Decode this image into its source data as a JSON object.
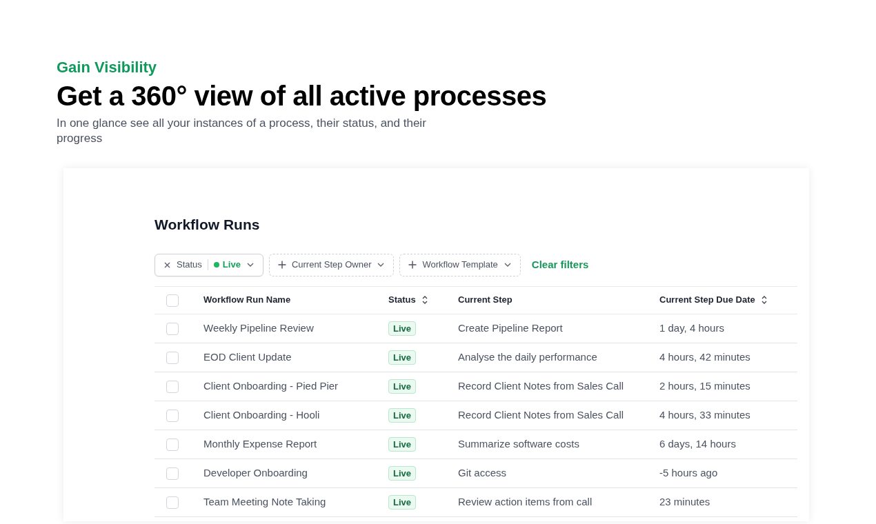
{
  "hero": {
    "eyebrow": "Gain Visibility",
    "heading": "Get a 360° view of all active processes",
    "subtitle": "In one glance see all your instances of a process, their status, and their progress"
  },
  "panel": {
    "title": "Workflow Runs",
    "filters": [
      {
        "kind": "applied",
        "label": "Status",
        "value": "Live"
      },
      {
        "kind": "add",
        "label": "Current Step Owner"
      },
      {
        "kind": "add",
        "label": "Workflow Template"
      }
    ],
    "clear_label": "Clear filters",
    "table": {
      "columns": [
        {
          "label": "Workflow Run Name",
          "sortable": false
        },
        {
          "label": "Status",
          "sortable": true
        },
        {
          "label": "Current Step",
          "sortable": false
        },
        {
          "label": "Current Step Due Date",
          "sortable": true
        }
      ],
      "header_checked": false,
      "rows": [
        {
          "checked": false,
          "name": "Weekly Pipeline Review",
          "status": "Live",
          "step": "Create Pipeline Report",
          "due": "1 day, 4 hours"
        },
        {
          "checked": false,
          "name": "EOD Client Update",
          "status": "Live",
          "step": "Analyse the daily performance",
          "due": "4 hours, 42 minutes"
        },
        {
          "checked": false,
          "name": "Client Onboarding - Pied Pier",
          "status": "Live",
          "step": "Record Client Notes from Sales Call",
          "due": "2 hours, 15 minutes"
        },
        {
          "checked": false,
          "name": "Client Onboarding - Hooli",
          "status": "Live",
          "step": "Record Client Notes from Sales Call",
          "due": "4 hours, 33 minutes"
        },
        {
          "checked": false,
          "name": "Monthly Expense Report",
          "status": "Live",
          "step": "Summarize software costs",
          "due": "6 days, 14 hours"
        },
        {
          "checked": false,
          "name": "Developer Onboarding",
          "status": "Live",
          "step": "Git access",
          "due": "-5 hours ago"
        },
        {
          "checked": false,
          "name": "Team Meeting Note Taking",
          "status": "Live",
          "step": "Review action items from call",
          "due": "23 minutes"
        }
      ]
    }
  }
}
